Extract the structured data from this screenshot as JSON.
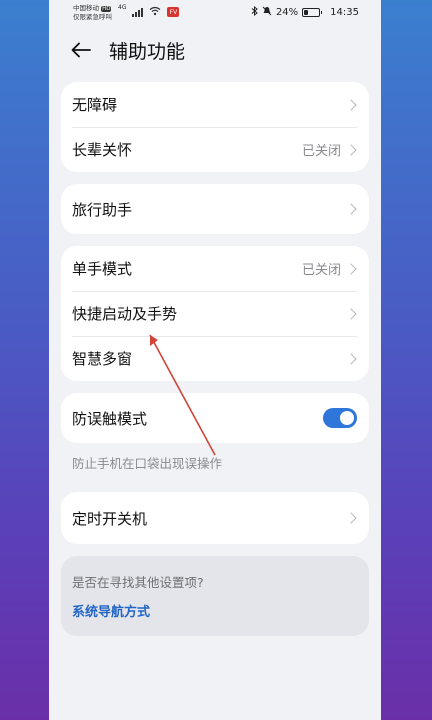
{
  "status_bar": {
    "carrier_line1": "中国移动",
    "carrier_hd": "HD",
    "carrier_line2": "仅限紧急呼叫",
    "network": "4G",
    "app_badge": "FV",
    "battery_text": "24%",
    "battery_level": 0.24,
    "time": "14:35"
  },
  "header": {
    "title": "辅助功能"
  },
  "groups": [
    {
      "rows": [
        {
          "label": "无障碍",
          "value": ""
        },
        {
          "label": "长辈关怀",
          "value": "已关闭"
        }
      ]
    },
    {
      "rows": [
        {
          "label": "旅行助手",
          "value": ""
        }
      ]
    },
    {
      "rows": [
        {
          "label": "单手模式",
          "value": "已关闭"
        },
        {
          "label": "快捷启动及手势",
          "value": ""
        },
        {
          "label": "智慧多窗",
          "value": ""
        }
      ]
    },
    {
      "rows": [
        {
          "label": "防误触模式",
          "toggle": true
        }
      ],
      "hint": "防止手机在口袋出现误操作"
    },
    {
      "rows": [
        {
          "label": "定时开关机",
          "value": ""
        }
      ]
    }
  ],
  "footer": {
    "question": "是否在寻找其他设置项?",
    "link": "系统导航方式"
  },
  "colors": {
    "accent": "#2e76d9",
    "link": "#2366c6",
    "annotation_arrow": "#d0453a"
  }
}
